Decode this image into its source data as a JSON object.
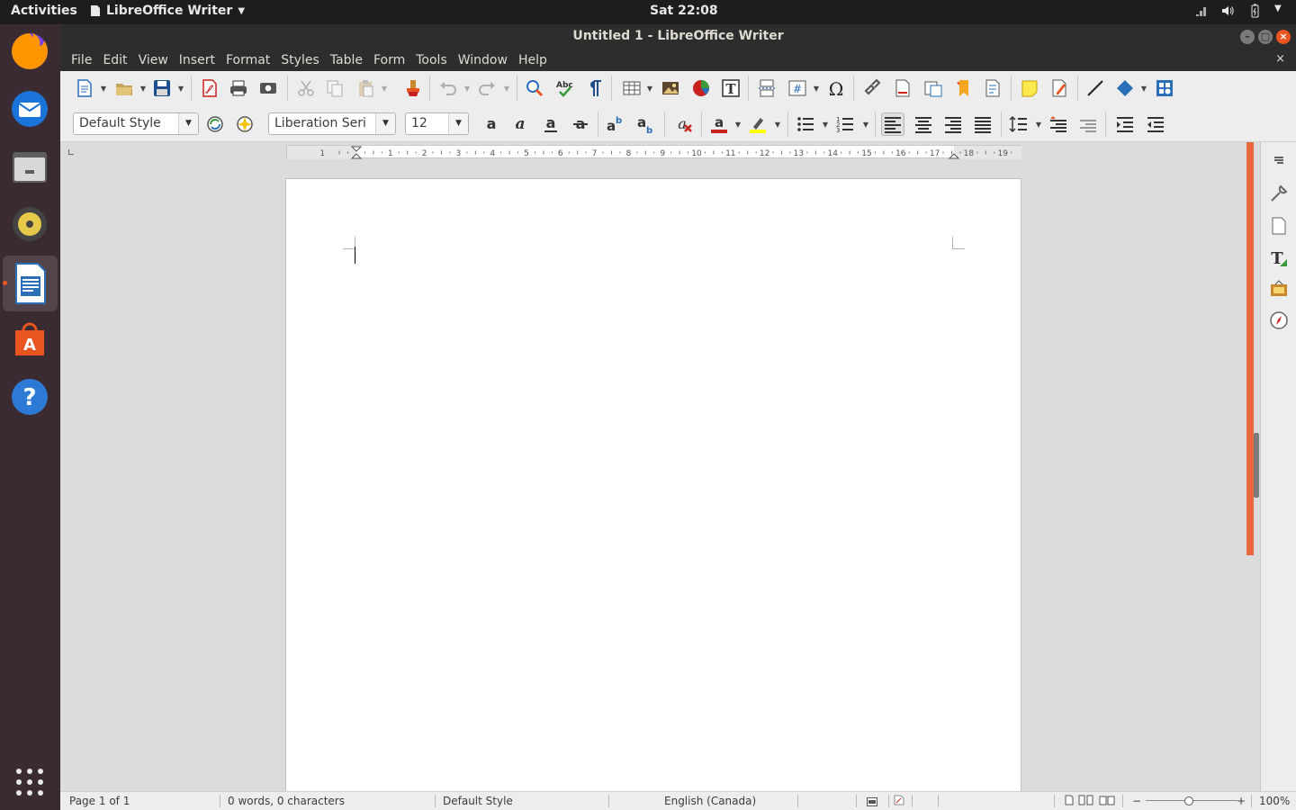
{
  "topbar": {
    "activities": "Activities",
    "app_name": "LibreOffice Writer",
    "clock": "Sat 22:08"
  },
  "dock": {
    "items": [
      {
        "name": "firefox-icon"
      },
      {
        "name": "thunderbird-icon"
      },
      {
        "name": "files-icon"
      },
      {
        "name": "rhythmbox-icon"
      },
      {
        "name": "libreoffice-writer-icon",
        "active": true
      },
      {
        "name": "software-center-icon"
      },
      {
        "name": "help-icon"
      },
      {
        "name": "show-applications-icon"
      }
    ]
  },
  "window": {
    "title": "Untitled 1 - LibreOffice Writer"
  },
  "menubar": {
    "items": [
      "File",
      "Edit",
      "View",
      "Insert",
      "Format",
      "Styles",
      "Table",
      "Form",
      "Tools",
      "Window",
      "Help"
    ],
    "close_doc": "×"
  },
  "formatting": {
    "paragraph_style": "Default Style",
    "font_name": "Liberation Seri",
    "font_size": "12"
  },
  "ruler": {
    "labels": [
      "1",
      "1",
      "2",
      "3",
      "4",
      "5",
      "6",
      "7",
      "8",
      "9",
      "10",
      "11",
      "12",
      "13",
      "14",
      "15",
      "16",
      "17",
      "18",
      "19"
    ]
  },
  "colors": {
    "accent": "#e95420",
    "font_color": "#c9211e",
    "highlight": "#ffff00"
  },
  "statusbar": {
    "page": "Page 1 of 1",
    "words": "0 words, 0 characters",
    "page_style": "Default Style",
    "language": "English (Canada)",
    "zoom": "100%",
    "zoom_minus": "−",
    "zoom_plus": "+"
  }
}
